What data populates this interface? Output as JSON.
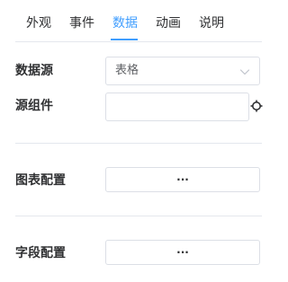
{
  "tabs": [
    {
      "label": "外观"
    },
    {
      "label": "事件"
    },
    {
      "label": "数据",
      "active": true
    },
    {
      "label": "动画"
    },
    {
      "label": "说明"
    }
  ],
  "form": {
    "datasource_label": "数据源",
    "datasource_value": "表格",
    "source_component_label": "源组件",
    "source_component_value": "",
    "chart_config_label": "图表配置",
    "chart_config_button": "···",
    "field_config_label": "字段配置",
    "field_config_button": "···"
  },
  "colors": {
    "accent": "#409eff",
    "text": "#303133",
    "border": "#dcdfe6",
    "divider": "#e4e7ed"
  },
  "icons": {
    "select_arrow": "chevron-down-icon",
    "pick_component": "crosshair-icon"
  }
}
